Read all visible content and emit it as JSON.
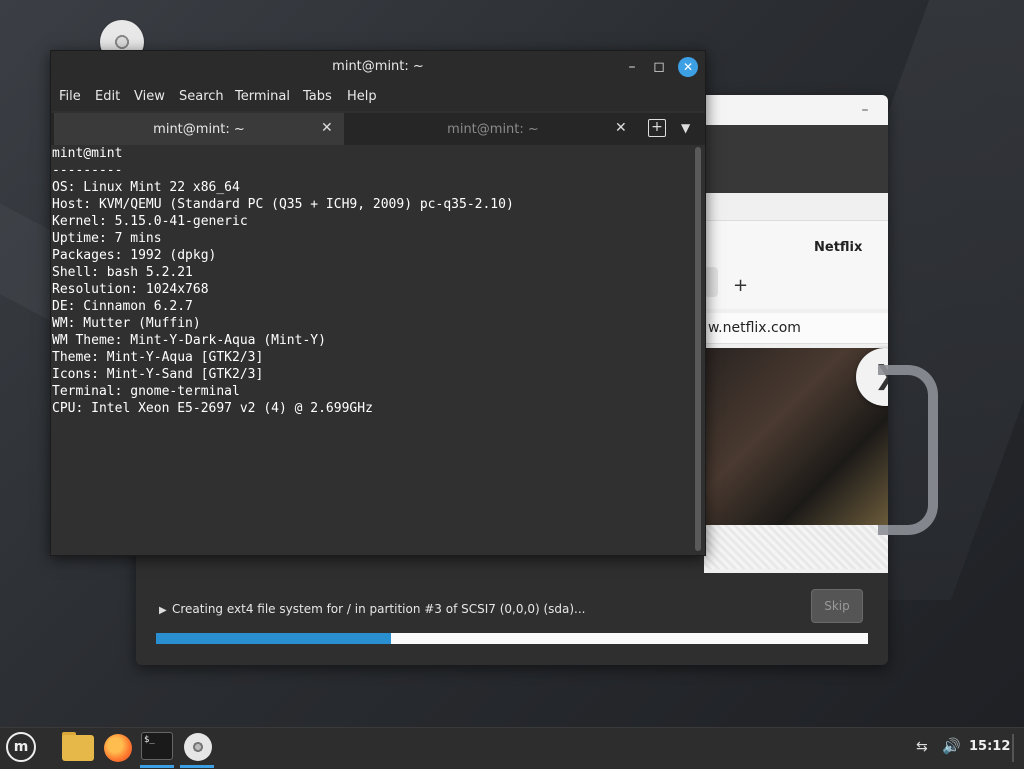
{
  "terminal": {
    "title": "mint@mint: ~",
    "menu": [
      "File",
      "Edit",
      "View",
      "Search",
      "Terminal",
      "Tabs",
      "Help"
    ],
    "tabs": [
      {
        "label": "mint@mint: ~",
        "active": true
      },
      {
        "label": "mint@mint: ~",
        "active": false
      }
    ],
    "output": "mint@mint\n---------\nOS: Linux Mint 22 x86_64\nHost: KVM/QEMU (Standard PC (Q35 + ICH9, 2009) pc-q35-2.10)\nKernel: 5.15.0-41-generic\nUptime: 7 mins\nPackages: 1992 (dpkg)\nShell: bash 5.2.21\nResolution: 1024x768\nDE: Cinnamon 6.2.7\nWM: Mutter (Muffin)\nWM Theme: Mint-Y-Dark-Aqua (Mint-Y)\nTheme: Mint-Y-Aqua [GTK2/3]\nIcons: Mint-Y-Sand [GTK2/3]\nTerminal: gnome-terminal\nCPU: Intel Xeon E5-2697 v2 (4) @ 2.699GHz"
  },
  "installer": {
    "slide_tab_title": "Netflix",
    "slide_url": "w.netflix.com",
    "status_text": "Creating ext4 file system for / in partition #3 of SCSI7 (0,0,0) (sda)...",
    "skip_label": "Skip",
    "progress": 0.33
  },
  "taskbar": {
    "clock": "15:12",
    "apps": [
      "menu-icon",
      "files-icon",
      "firefox-icon",
      "terminal-icon",
      "disc-icon"
    ]
  },
  "colors": {
    "accent": "#3ea0e4",
    "progress": "#2a8fd0",
    "terminal_bg": "#303030"
  }
}
